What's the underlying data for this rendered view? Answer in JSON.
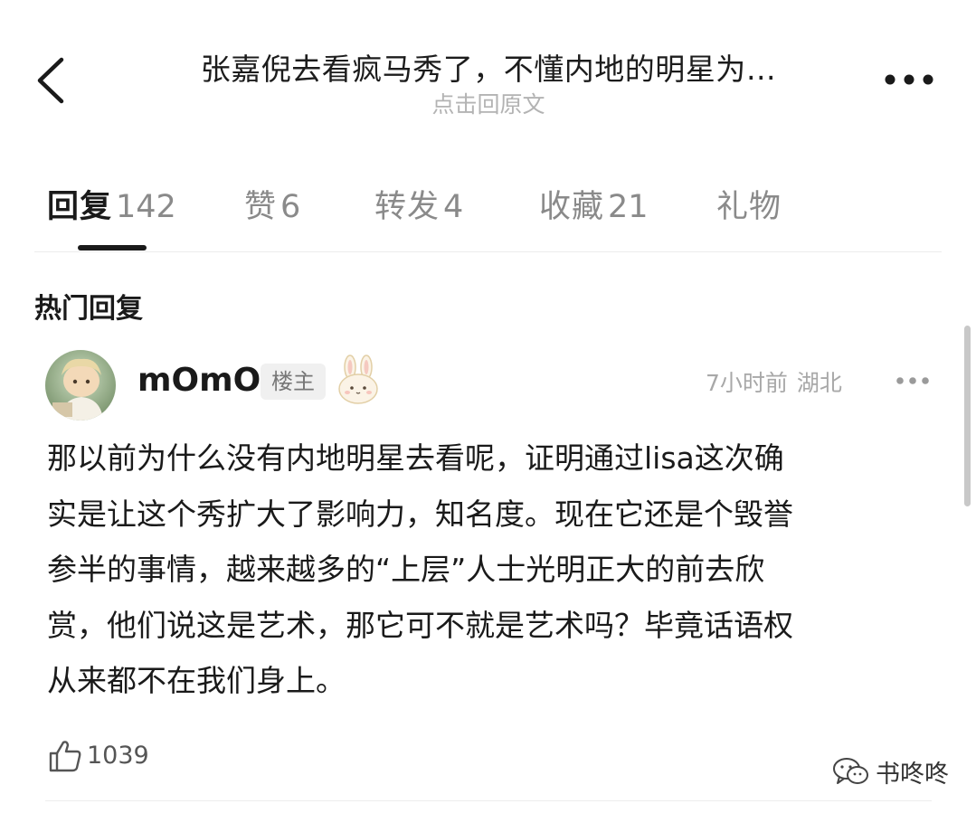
{
  "header": {
    "title": "张嘉倪去看疯马秀了，不懂内地的明星为…",
    "subtitle": "点击回原文"
  },
  "tabs": [
    {
      "label": "回复",
      "count": "142"
    },
    {
      "label": "赞",
      "count": "6"
    },
    {
      "label": "转发",
      "count": "4"
    },
    {
      "label": "收藏",
      "count": "21"
    },
    {
      "label": "礼物",
      "count": ""
    }
  ],
  "section_title": "热门回复",
  "comment": {
    "username": "mOmO",
    "badge": "楼主",
    "time": "7小时前",
    "location": "湖北",
    "text_lines": [
      "那以前为什么没有内地明星去看呢，证明通过lisa这次确",
      "实是让这个秀扩大了影响力，知名度。现在它还是个毁誉",
      "参半的事情，越来越多的“上层”人士光明正大的前去欣",
      "赏，他们说这是艺术，那它可不就是艺术吗？毕竟话语权",
      "从来都不在我们身上。"
    ],
    "likes": "1039"
  },
  "watermark": "书咚咚",
  "icons": {
    "back": "chevron-left-icon",
    "more": "more-dots-icon",
    "like": "thumbs-up-icon",
    "watermark": "wechat-icon",
    "bunny": "bunny-sticker-icon"
  },
  "colors": {
    "text": "#1a1a1a",
    "muted": "#8a8a8a",
    "light": "#b3b3b3"
  }
}
